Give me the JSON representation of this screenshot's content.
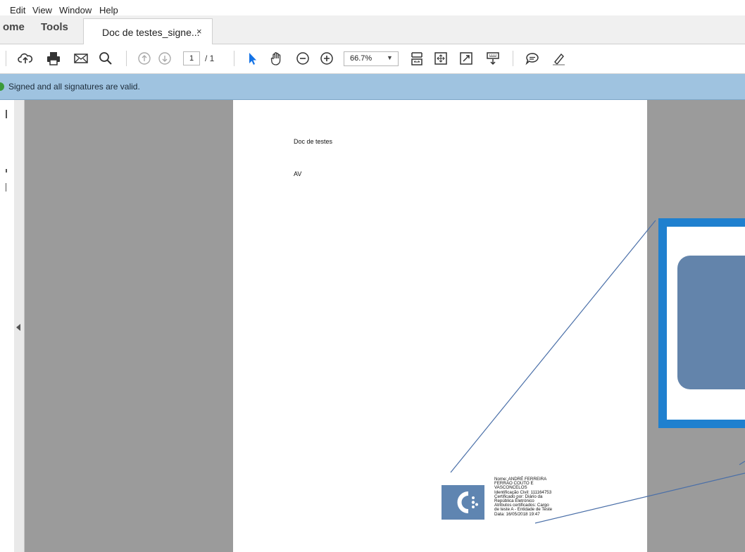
{
  "menu": {
    "items": [
      "Edit",
      "View",
      "Window",
      "Help"
    ]
  },
  "tabs": {
    "home_label": "ome",
    "tools_label": "Tools",
    "doc_label": "Doc de testes_signe...",
    "close_glyph": "×"
  },
  "toolbar": {
    "page_current": "1",
    "page_total": "/ 1",
    "zoom_value": "66.7%",
    "icons": [
      "upload-icon",
      "print-icon",
      "email-icon",
      "search-icon",
      "previous-page-icon",
      "next-page-icon",
      "select-cursor-icon",
      "hand-icon",
      "zoom-out-icon",
      "zoom-in-icon",
      "fit-page-icon",
      "full-screen-icon",
      "expand-icon",
      "read-mode-icon",
      "comment-icon",
      "highlight-icon"
    ]
  },
  "signature_bar": {
    "message": "Signed and all signatures are valid.",
    "status_color": "#3a9a3a"
  },
  "document": {
    "title": "Doc de testes",
    "body": "AV",
    "signature_lines": [
      "Nome: ANDRÉ FERREIRA",
      "FERRÃO COUTO E",
      "VASCONCELOS",
      "Identificação Civil: 111164753",
      "Certificado por: Diário da",
      "República Eletrónico",
      "Atributos certificados: Cargo",
      "de teste A - Entidade de Teste",
      "Data: 16/05/2018 19:47"
    ]
  },
  "colors": {
    "signature_bar": "#9fc3e0",
    "callout_border": "#1f80cf",
    "logo": "#5f85b1",
    "accent_icon": "#1473e6"
  }
}
